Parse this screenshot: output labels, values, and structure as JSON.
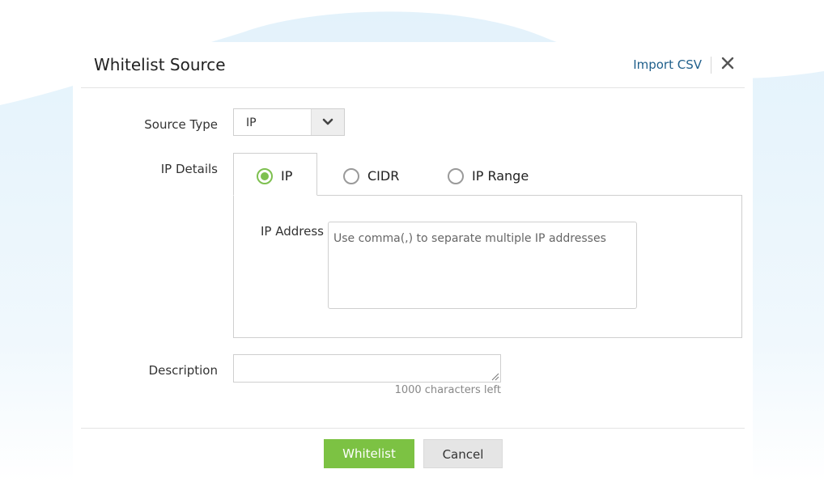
{
  "dialog": {
    "title": "Whitelist Source",
    "import_label": "Import CSV",
    "close_icon": "close-icon"
  },
  "form": {
    "source_type": {
      "label": "Source Type",
      "value": "IP"
    },
    "ip_details": {
      "label": "IP Details",
      "options": [
        "IP",
        "CIDR",
        "IP Range"
      ],
      "selected": "IP"
    },
    "ip_address": {
      "label": "IP Address",
      "placeholder": "Use comma(,) to separate multiple IP addresses"
    },
    "description": {
      "label": "Description",
      "value": "",
      "chars_left": "1000 characters left"
    }
  },
  "footer": {
    "primary_label": "Whitelist",
    "secondary_label": "Cancel"
  },
  "colors": {
    "accent": "#7cc243",
    "link": "#1f5f8b",
    "background_shape": "#e6f3fb"
  }
}
